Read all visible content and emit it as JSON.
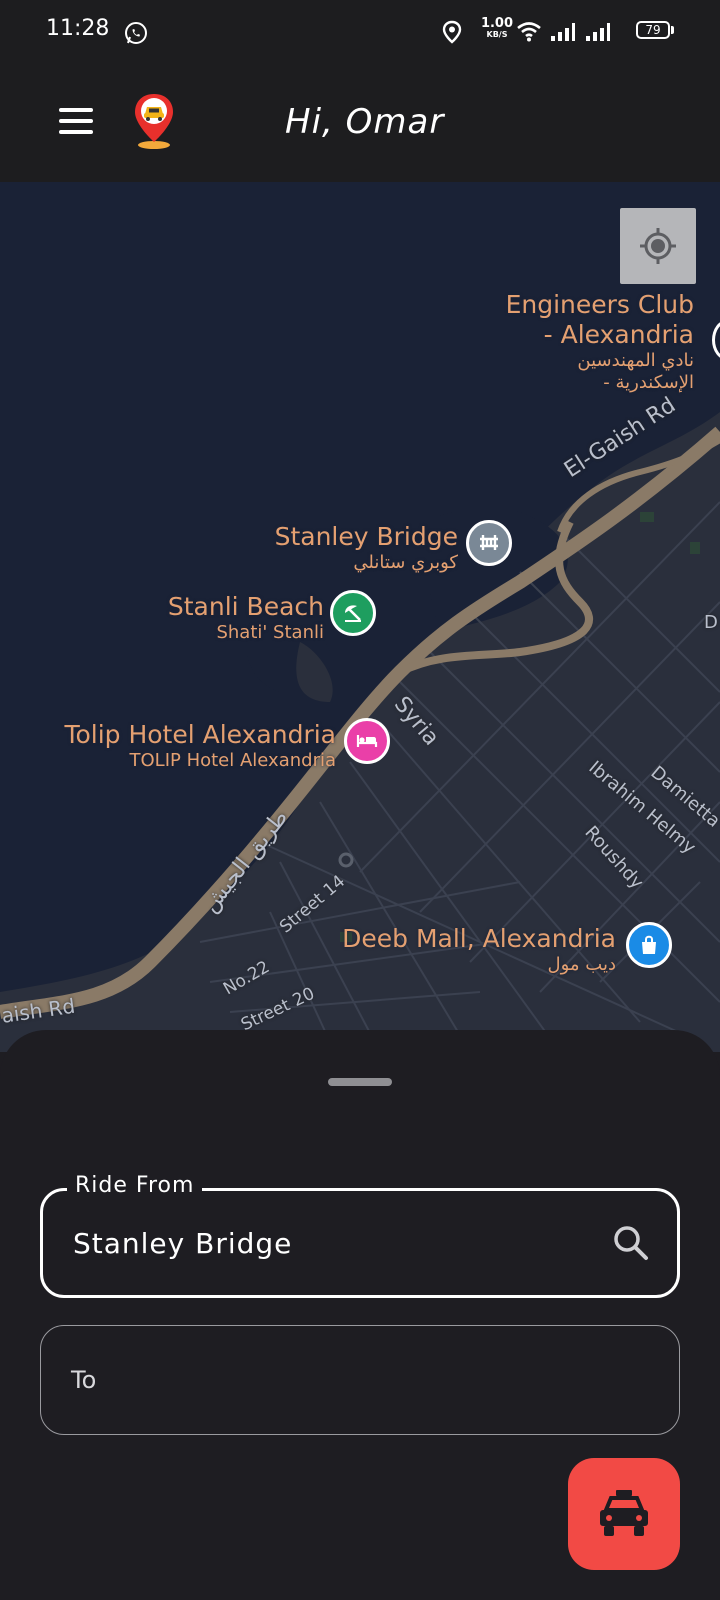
{
  "status_bar": {
    "time": "11:28",
    "net_speed_value": "1.00",
    "net_speed_unit": "KB/S",
    "battery": "79",
    "icons": [
      "whatsapp-icon",
      "location-icon",
      "wifi-icon",
      "signal-icon",
      "signal-icon",
      "battery-icon"
    ]
  },
  "app_bar": {
    "greeting": "Hi, Omar",
    "menu_icon": "hamburger-menu-icon",
    "logo_icon": "taxi-pin-logo"
  },
  "map": {
    "locate_icon": "my-location-icon",
    "pois": [
      {
        "name": "Engineers Club",
        "name2": "- Alexandria",
        "sub": "نادي المهندسين",
        "sub2": "- الإسكندرية",
        "icon": "club-icon"
      },
      {
        "name": "Stanley Bridge",
        "sub": "كوبري ستانلي",
        "icon": "bridge-icon",
        "color": "#7a8896"
      },
      {
        "name": "Stanli Beach",
        "sub": "Shati' Stanli",
        "icon": "beach-umbrella-icon",
        "color": "#1e9e5f"
      },
      {
        "name": "Tolip Hotel Alexandria",
        "sub": "TOLIP Hotel Alexandria",
        "icon": "hotel-bed-icon",
        "color": "#ea3fa8"
      },
      {
        "name": "Deeb Mall, Alexandria",
        "sub": "ديب مول",
        "icon": "shopping-bag-icon",
        "color": "#1a8be6"
      }
    ],
    "roads": {
      "el_gaish": "El-Gaish Rd",
      "syria": "Syria",
      "tareeq": "طريق الجيش",
      "ibrahim": "Ibrahim Helmy",
      "damietta": "Damietta",
      "roushdy": "Roushdy",
      "street14": "Street 14",
      "no22": "No.22",
      "street20": "Street 20",
      "gaish_left": "aish Rd",
      "d_edge": "D"
    },
    "colors": {
      "water": "#1a2236",
      "land": "#2a2f3c",
      "road": "#8a7a67"
    }
  },
  "sheet": {
    "from_label": "Ride From",
    "from_value": "Stanley Bridge",
    "to_placeholder": "To",
    "search_icon": "search-icon",
    "fab_icon": "taxi-icon",
    "fab_color": "#f24a45"
  }
}
